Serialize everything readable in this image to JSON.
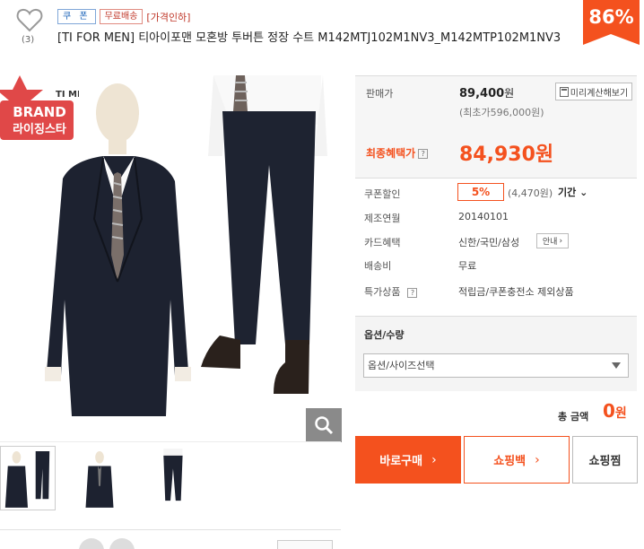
{
  "header": {
    "like_count": "(3)",
    "badges": {
      "coupon": "쿠 폰",
      "free_shipping": "무료배송",
      "price_down": "[가격인하]"
    },
    "title": "[TI FOR MEN] 티아이포맨 모혼방 투버튼 정장 수트 M142MTJ102M1NV3_M142MTP102M1NV3",
    "discount": "86%"
  },
  "brand_badge": {
    "line1": "BRAND",
    "line2": "라이징스타",
    "logo_partial": "TI MEN"
  },
  "price": {
    "sale_label": "판매가",
    "sale_value": "89,400",
    "sale_unit": "원",
    "list_price": "(최초가596,000원)",
    "calc_button": "미리계산해보기",
    "final_label": "최종혜택가",
    "final_value": "84,930원"
  },
  "details": {
    "coupon_label": "쿠폰할인",
    "coupon_pct": "5%",
    "coupon_amount": "(4,470원)",
    "period": "기간",
    "made_label": "제조연월",
    "made_value": "20140101",
    "card_label": "카드혜택",
    "card_value": "신한/국민/삼성",
    "card_info_button": "안내",
    "shipping_label": "배송비",
    "shipping_value": "무료",
    "special_label": "특가상품",
    "special_value": "적립금/쿠폰충전소 제외상품"
  },
  "option": {
    "title": "옵션/수량",
    "select_value": "옵션/사이즈선택"
  },
  "total": {
    "label": "총 금액",
    "value": "0",
    "unit": "원"
  },
  "actions": {
    "buy": "바로구매",
    "bag": "쇼핑백",
    "wish": "쇼핑찜"
  },
  "colors": {
    "accent": "#f4511e",
    "suit": "#1b1f2b",
    "badge_red": "#e04848"
  }
}
